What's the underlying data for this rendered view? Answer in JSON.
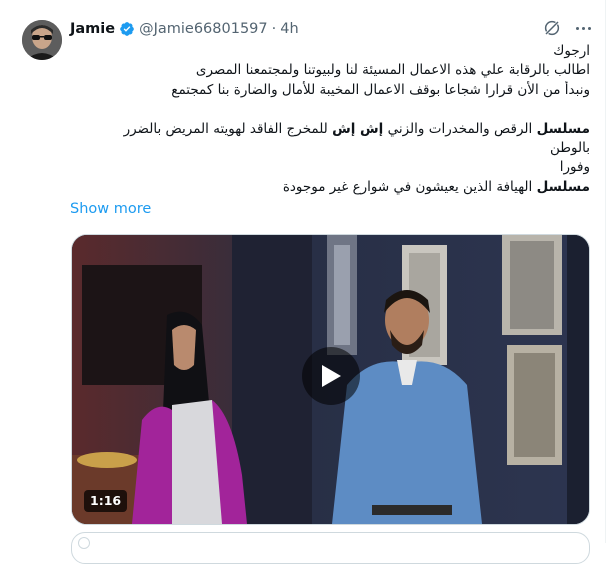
{
  "author": {
    "display_name": "Jamie",
    "handle": "@Jamie66801597",
    "separator": "·",
    "time": "4h"
  },
  "tweet": {
    "lines": [
      {
        "text": "ارجوك"
      },
      {
        "text": "اطالب بالرقابة علي هذه الاعمال المسيئة لنا ولبيوتنا ولمجتمعنا المصرى"
      },
      {
        "text": "ونبدأ من الأن قرارا شجاعا بوقف الاعمال المخيبة للأمال والضارة بنا كمجتمع"
      },
      {
        "text": ""
      },
      {
        "bold1": "مسلسل",
        "text1": " الرقص والمخدرات والزني ",
        "bold2": "إش إش",
        "text2": " للمخرج الفاقد لهويته المريض بالضرر"
      },
      {
        "text": "بالوطن"
      },
      {
        "text": "وفورا"
      },
      {
        "bold1": "مسلسل",
        "text1": " الهيافة الذين يعيشون في شوارع غير موجودة"
      }
    ],
    "show_more": "Show more"
  },
  "video": {
    "duration": "1:16"
  },
  "colors": {
    "link": "#1d9bf0",
    "verified": "#1d9bf0",
    "secondary_text": "#536471"
  },
  "icons": [
    "verified-badge-icon",
    "grok-icon",
    "more-options-icon",
    "play-icon"
  ]
}
